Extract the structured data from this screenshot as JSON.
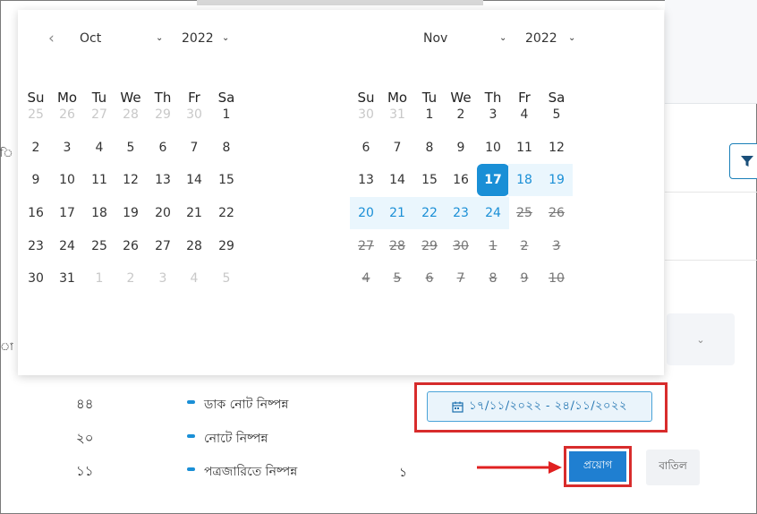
{
  "page": {
    "stats": [
      {
        "count": "৪৪",
        "label": "ডাক নোট নিষ্পন্ন"
      },
      {
        "count": "২০",
        "label": "নোটে নিষ্পন্ন"
      },
      {
        "count": "১১",
        "label": "পত্রজারিতে নিষ্পন্ন",
        "extra": "১"
      }
    ],
    "date_range": "১৭/১১/২০২২ - ২৪/১১/২০২২",
    "apply_label": "প্রয়োগ",
    "cancel_label": "বাতিল"
  },
  "calendar": {
    "weekdays": [
      "Su",
      "Mo",
      "Tu",
      "We",
      "Th",
      "Fr",
      "Sa"
    ],
    "months": [
      {
        "month": "Oct",
        "year": "2022",
        "weeks": [
          [
            "25",
            "26",
            "27",
            "28",
            "29",
            "30",
            "1"
          ],
          [
            "2",
            "3",
            "4",
            "5",
            "6",
            "7",
            "8"
          ],
          [
            "9",
            "10",
            "11",
            "12",
            "13",
            "14",
            "15"
          ],
          [
            "16",
            "17",
            "18",
            "19",
            "20",
            "21",
            "22"
          ],
          [
            "23",
            "24",
            "25",
            "26",
            "27",
            "28",
            "29"
          ],
          [
            "30",
            "31",
            "1",
            "2",
            "3",
            "4",
            "5"
          ]
        ]
      },
      {
        "month": "Nov",
        "year": "2022",
        "weeks": [
          [
            "30",
            "31",
            "1",
            "2",
            "3",
            "4",
            "5"
          ],
          [
            "6",
            "7",
            "8",
            "9",
            "10",
            "11",
            "12"
          ],
          [
            "13",
            "14",
            "15",
            "16",
            "17",
            "18",
            "19"
          ],
          [
            "20",
            "21",
            "22",
            "23",
            "24",
            "25",
            "26"
          ],
          [
            "27",
            "28",
            "29",
            "30",
            "1",
            "2",
            "3"
          ],
          [
            "4",
            "5",
            "6",
            "7",
            "8",
            "9",
            "10"
          ]
        ]
      }
    ],
    "selected_start": "17",
    "selected_end": "24"
  },
  "colors": {
    "accent": "#1a8fd6",
    "range_bg": "#eaf6fd",
    "highlight_border": "#d82c2c",
    "apply_bg": "#1f7fd1"
  }
}
